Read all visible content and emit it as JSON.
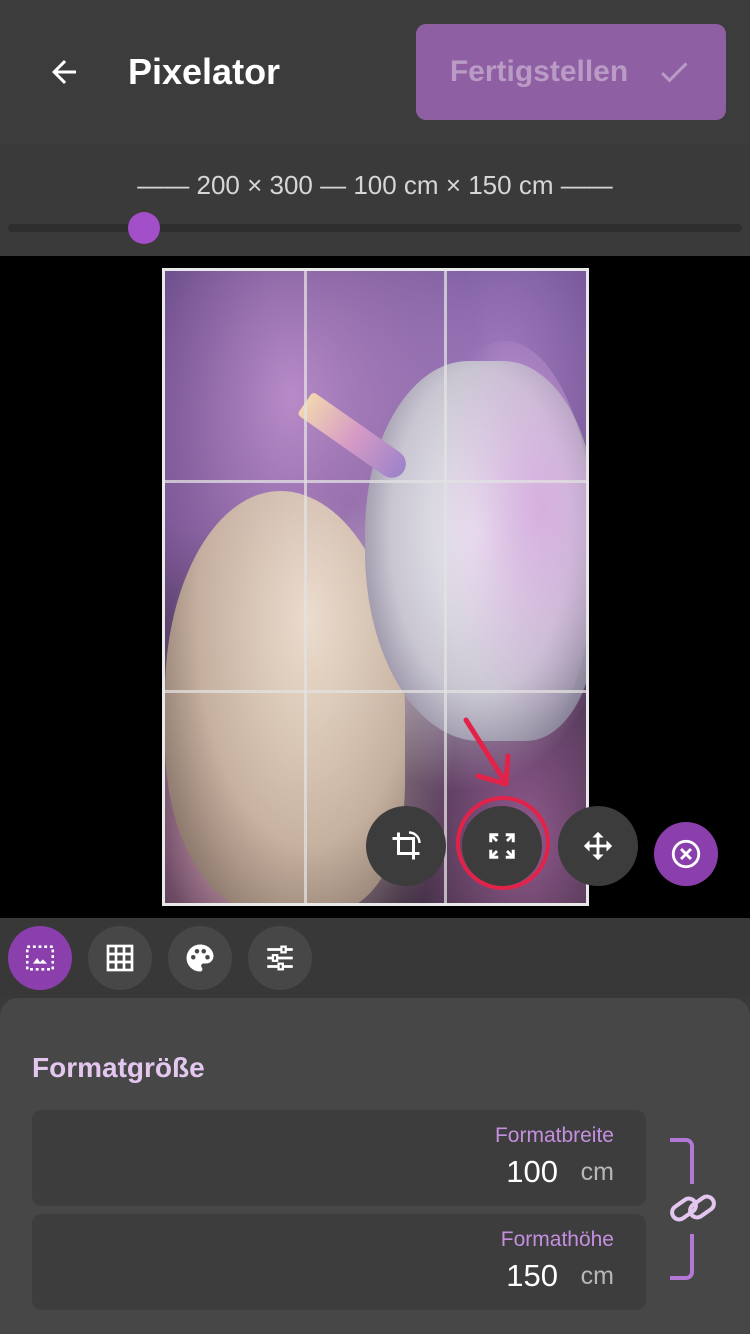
{
  "header": {
    "title": "Pixelator",
    "finish_label": "Fertigstellen"
  },
  "sizebar": {
    "text": "—— 200 × 300 — 100 cm × 150 cm ——",
    "slider_level": 0.18
  },
  "canvas": {
    "tools": [
      "crop-rotate-icon",
      "fullscreen-icon",
      "move-icon"
    ],
    "close_icon": "close-circle-icon",
    "highlighted_tool": "fullscreen-icon"
  },
  "tabs": [
    {
      "icon": "image-frame-icon",
      "active": true
    },
    {
      "icon": "grid-icon",
      "active": false
    },
    {
      "icon": "palette-icon",
      "active": false
    },
    {
      "icon": "sliders-icon",
      "active": false
    }
  ],
  "panel": {
    "title": "Formatgröße",
    "width": {
      "label": "Formatbreite",
      "value": "100",
      "unit": "cm"
    },
    "height": {
      "label": "Formathöhe",
      "value": "150",
      "unit": "cm"
    },
    "link_icon": "link-icon"
  },
  "colors": {
    "accent": "#8a3fad",
    "slider_thumb": "#a24fc9",
    "highlight": "#e3224a",
    "label": "#c58fe0"
  }
}
